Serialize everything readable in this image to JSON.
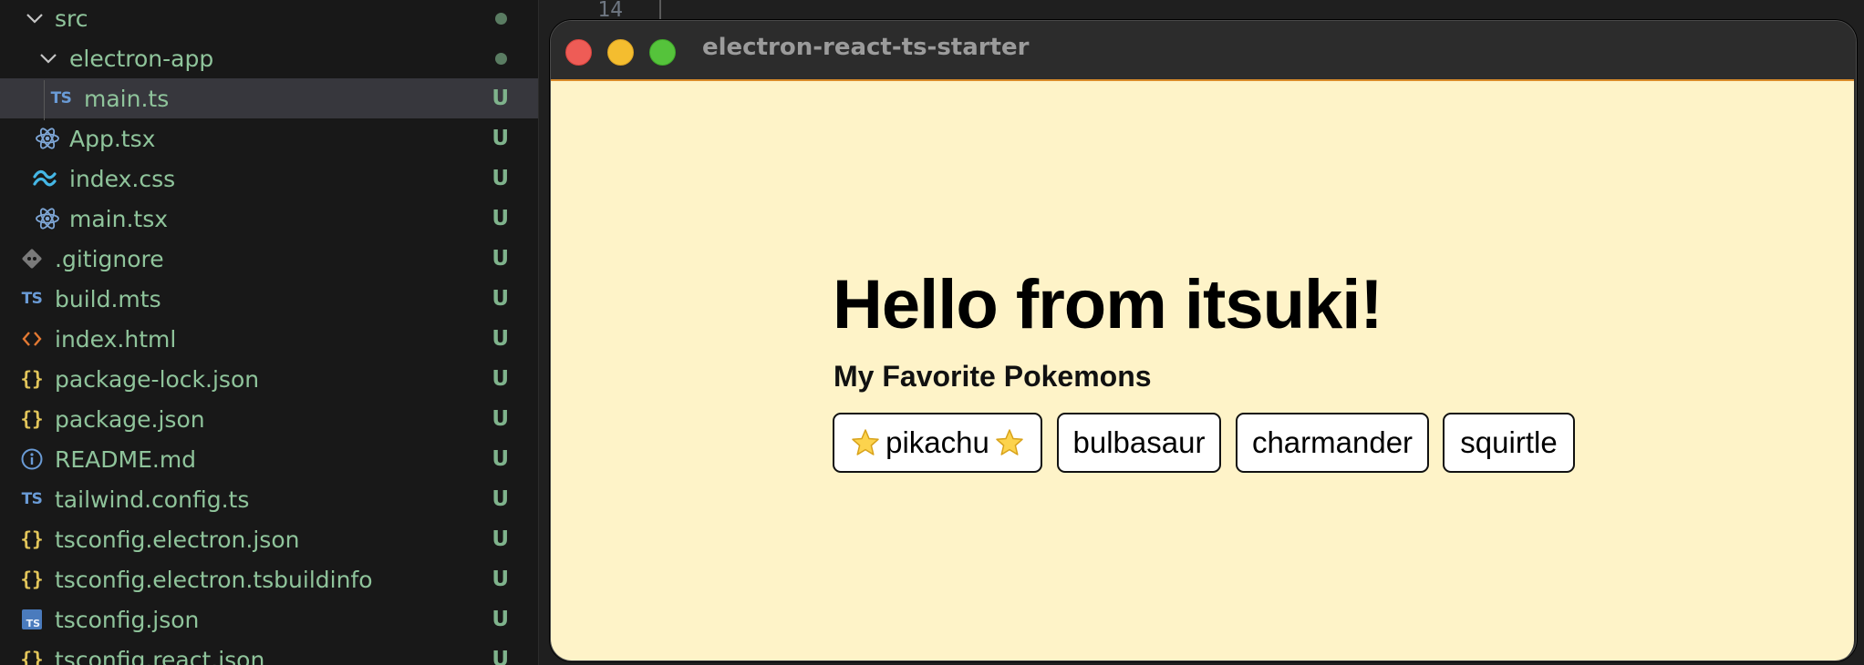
{
  "explorer": {
    "items": [
      {
        "name": "src",
        "icon": "chevron-down-icon",
        "type": "folder",
        "status": "dot"
      },
      {
        "name": "electron-app",
        "icon": "chevron-down-icon",
        "type": "folder",
        "status": "dot"
      },
      {
        "name": "main.ts",
        "icon": "typescript-file-icon",
        "icon_text": "TS",
        "status": "U",
        "selected": true
      },
      {
        "name": "App.tsx",
        "icon": "react-file-icon",
        "status": "U"
      },
      {
        "name": "index.css",
        "icon": "tailwind-file-icon",
        "status": "U"
      },
      {
        "name": "main.tsx",
        "icon": "react-file-icon",
        "status": "U"
      },
      {
        "name": ".gitignore",
        "icon": "git-file-icon",
        "status": "U"
      },
      {
        "name": "build.mts",
        "icon": "typescript-file-icon",
        "icon_text": "TS",
        "status": "U"
      },
      {
        "name": "index.html",
        "icon": "html-file-icon",
        "icon_text": "<>",
        "status": "U"
      },
      {
        "name": "package-lock.json",
        "icon": "json-file-icon",
        "icon_text": "{}",
        "status": "U"
      },
      {
        "name": "package.json",
        "icon": "json-file-icon",
        "icon_text": "{}",
        "status": "U"
      },
      {
        "name": "README.md",
        "icon": "info-file-icon",
        "status": "U"
      },
      {
        "name": "tailwind.config.ts",
        "icon": "typescript-file-icon",
        "icon_text": "TS",
        "status": "U"
      },
      {
        "name": "tsconfig.electron.json",
        "icon": "json-file-icon",
        "icon_text": "{}",
        "status": "U"
      },
      {
        "name": "tsconfig.electron.tsbuildinfo",
        "icon": "json-file-icon",
        "icon_text": "{}",
        "status": "U"
      },
      {
        "name": "tsconfig.json",
        "icon": "tsconfig-file-icon",
        "icon_text": "TS",
        "status": "U"
      },
      {
        "name": "tsconfig.react.json",
        "icon": "json-file-icon",
        "icon_text": "{}",
        "status": "U"
      }
    ]
  },
  "editor": {
    "line_number": "14"
  },
  "app_window": {
    "title": "electron-react-ts-starter",
    "heading": "Hello from itsuki!",
    "subtitle": "My Favorite Pokemons",
    "pokemons": [
      {
        "label": "pikachu",
        "favorite": true
      },
      {
        "label": "bulbasaur",
        "favorite": false
      },
      {
        "label": "charmander",
        "favorite": false
      },
      {
        "label": "squirtle",
        "favorite": false
      }
    ]
  },
  "colors": {
    "close": "#ee5c56",
    "minimize": "#f4bd2f",
    "zoom": "#55c33b",
    "content_bg": "#fef3c8",
    "file_name": "#8fc49b"
  }
}
